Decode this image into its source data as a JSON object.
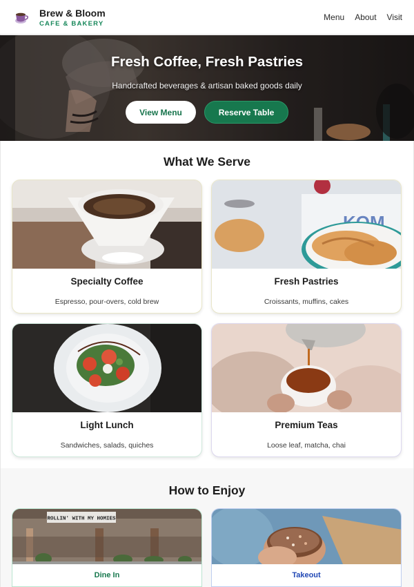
{
  "brand": {
    "name": "Brew & Bloom",
    "tagline": "CAFE & BAKERY",
    "logo_icon": "coffee-cup-icon"
  },
  "nav": {
    "items": [
      {
        "label": "Menu"
      },
      {
        "label": "About"
      },
      {
        "label": "Visit"
      }
    ]
  },
  "hero": {
    "title": "Fresh Coffee, Fresh Pastries",
    "subtitle": "Handcrafted beverages & artisan baked goods daily",
    "primary_button": "View Menu",
    "secondary_button": "Reserve Table"
  },
  "serve": {
    "title": "What We Serve",
    "cards": [
      {
        "title": "Specialty Coffee",
        "description": "Espresso, pour-overs, cold brew"
      },
      {
        "title": "Fresh Pastries",
        "description": "Croissants, muffins, cakes"
      },
      {
        "title": "Light Lunch",
        "description": "Sandwiches, salads, quiches"
      },
      {
        "title": "Premium Teas",
        "description": "Loose leaf, matcha, chai"
      }
    ]
  },
  "enjoy": {
    "title": "How to Enjoy",
    "options": [
      {
        "label": "Dine In",
        "sign_text": "ROLLIN' WITH MY HOMIES"
      },
      {
        "label": "Takeout"
      }
    ]
  },
  "colors": {
    "accent_green": "#17784e",
    "tagline_green": "#17875a",
    "takeout_blue": "#2148b5"
  }
}
